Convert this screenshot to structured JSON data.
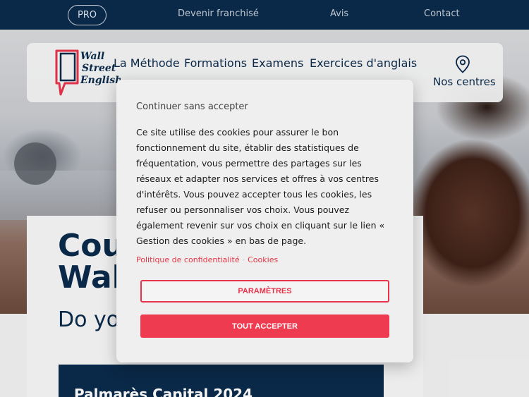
{
  "topbar": {
    "pro_label": "PRO",
    "links": [
      "Devenir franchisé",
      "Avis",
      "Contact"
    ]
  },
  "nav": {
    "logo_text": [
      "Wall",
      "Street",
      "English"
    ],
    "items": [
      "La Méthode",
      "Formations",
      "Examens",
      "Exercices d'anglais"
    ],
    "centres_label": "Nos centres",
    "centres_icon": "map-pin-icon"
  },
  "hero": {
    "title_line1": "Cou",
    "title_line2": "Wall",
    "subtitle": "Do yo",
    "card_title": "Palmarès Capital 2024"
  },
  "cookie_modal": {
    "continue_label": "Continuer sans accepter",
    "body": "Ce site utilise des cookies pour assurer le bon fonctionnement du site, établir des statistiques de fréquentation, vous permettre des partages sur les réseaux et adapter nos services et offres à vos centres d'intérêts. Vous pouvez accepter tous les cookies, les refuser ou personnaliser vos choix. Vous pouvez également revenir sur vos choix en cliquant sur le lien « Gestion des cookies » en bas de page.",
    "privacy_link": "Politique de confidentialité",
    "cookies_link": "Cookies",
    "params_button": "PARAMÈTRES",
    "accept_button": "TOUT ACCEPTER"
  },
  "colors": {
    "navy": "#0b2a4a",
    "accent_red": "#ef3b50"
  }
}
